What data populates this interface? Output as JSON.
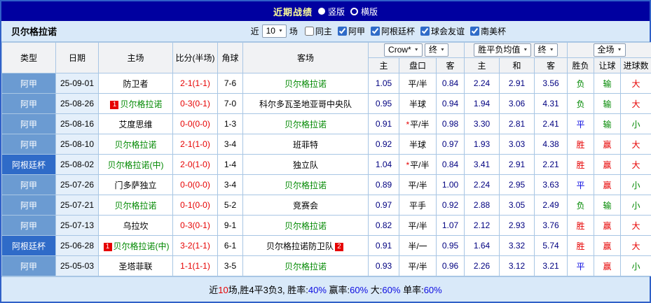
{
  "titlebar": {
    "title": "近期战绩",
    "options": [
      {
        "label": "竖版",
        "selected": true
      },
      {
        "label": "横版",
        "selected": false
      }
    ]
  },
  "filterbar": {
    "team": "贝尔格拉诺",
    "near_label": "近",
    "count": "10",
    "games_label": "场",
    "checkboxes": [
      {
        "label": "同主",
        "checked": false
      },
      {
        "label": "阿甲",
        "checked": true
      },
      {
        "label": "阿根廷杯",
        "checked": true
      },
      {
        "label": "球会友谊",
        "checked": true
      },
      {
        "label": "南美杯",
        "checked": true
      }
    ]
  },
  "colors": {
    "red": "#E60000",
    "green": "#008800",
    "blue": "#0B0BE0",
    "black": "#000000",
    "navy": "#000080",
    "league_cell": "#6B9BD2",
    "cup_cell": "#2F6BC8",
    "titlebar": "#0000A0",
    "panel_bg": "#D9E9F9"
  },
  "table": {
    "columns": {
      "type": "类型",
      "date": "日期",
      "home": "主场",
      "score": "比分(半场)",
      "corner": "角球",
      "away": "客场"
    },
    "groups": [
      {
        "selects": [
          "Crow*",
          "终"
        ],
        "sub": [
          "主",
          "盘口",
          "客"
        ]
      },
      {
        "selects": [
          "胜平负均值",
          "终"
        ],
        "sub": [
          "主",
          "和",
          "客"
        ]
      },
      {
        "selects": [
          "全场"
        ],
        "sub": [
          "胜负",
          "让球",
          "进球数"
        ]
      }
    ],
    "rows": [
      {
        "type": "阿甲",
        "cup": false,
        "date": "25-09-01",
        "home": {
          "text": "防卫者",
          "green": false
        },
        "score": "2-1(1-1)",
        "corner": "7-6",
        "away": {
          "text": "贝尔格拉诺",
          "green": true
        },
        "asian": [
          "1.05",
          "平/半",
          "0.84"
        ],
        "star": false,
        "europe": [
          "2.24",
          "2.91",
          "3.56"
        ],
        "result": {
          "text": "负",
          "color": "green"
        },
        "cover": {
          "text": "输",
          "color": "green"
        },
        "total": {
          "text": "大",
          "color": "red"
        }
      },
      {
        "type": "阿甲",
        "cup": false,
        "date": "25-08-26",
        "home": {
          "text": "贝尔格拉诺",
          "green": true,
          "badge_before": "1"
        },
        "score": "0-3(0-1)",
        "corner": "7-0",
        "away": {
          "text": "科尔多瓦圣地亚哥中央队",
          "green": false
        },
        "asian": [
          "0.95",
          "半球",
          "0.94"
        ],
        "star": false,
        "europe": [
          "1.94",
          "3.06",
          "4.31"
        ],
        "result": {
          "text": "负",
          "color": "green"
        },
        "cover": {
          "text": "输",
          "color": "green"
        },
        "total": {
          "text": "大",
          "color": "red"
        }
      },
      {
        "type": "阿甲",
        "cup": false,
        "date": "25-08-16",
        "home": {
          "text": "艾度思维",
          "green": false
        },
        "score": "0-0(0-0)",
        "corner": "1-3",
        "away": {
          "text": "贝尔格拉诺",
          "green": true
        },
        "asian": [
          "0.91",
          "平/半",
          "0.98"
        ],
        "star": true,
        "europe": [
          "3.30",
          "2.81",
          "2.41"
        ],
        "result": {
          "text": "平",
          "color": "blue"
        },
        "cover": {
          "text": "输",
          "color": "green"
        },
        "total": {
          "text": "小",
          "color": "green"
        }
      },
      {
        "type": "阿甲",
        "cup": false,
        "date": "25-08-10",
        "home": {
          "text": "贝尔格拉诺",
          "green": true
        },
        "score": "2-1(1-0)",
        "corner": "3-4",
        "away": {
          "text": "班菲特",
          "green": false
        },
        "asian": [
          "0.92",
          "半球",
          "0.97"
        ],
        "star": false,
        "europe": [
          "1.93",
          "3.03",
          "4.38"
        ],
        "result": {
          "text": "胜",
          "color": "red"
        },
        "cover": {
          "text": "赢",
          "color": "red"
        },
        "total": {
          "text": "大",
          "color": "red"
        }
      },
      {
        "type": "阿根廷杯",
        "cup": true,
        "date": "25-08-02",
        "home": {
          "text": "贝尔格拉诺(中)",
          "green": true
        },
        "score": "2-0(1-0)",
        "corner": "1-4",
        "away": {
          "text": "独立队",
          "green": false
        },
        "asian": [
          "1.04",
          "平/半",
          "0.84"
        ],
        "star": true,
        "europe": [
          "3.41",
          "2.91",
          "2.21"
        ],
        "result": {
          "text": "胜",
          "color": "red"
        },
        "cover": {
          "text": "赢",
          "color": "red"
        },
        "total": {
          "text": "大",
          "color": "red"
        }
      },
      {
        "type": "阿甲",
        "cup": false,
        "date": "25-07-26",
        "home": {
          "text": "门多萨独立",
          "green": false
        },
        "score": "0-0(0-0)",
        "corner": "3-4",
        "away": {
          "text": "贝尔格拉诺",
          "green": true
        },
        "asian": [
          "0.89",
          "平/半",
          "1.00"
        ],
        "star": false,
        "europe": [
          "2.24",
          "2.95",
          "3.63"
        ],
        "result": {
          "text": "平",
          "color": "blue"
        },
        "cover": {
          "text": "赢",
          "color": "red"
        },
        "total": {
          "text": "小",
          "color": "green"
        }
      },
      {
        "type": "阿甲",
        "cup": false,
        "date": "25-07-21",
        "home": {
          "text": "贝尔格拉诺",
          "green": true
        },
        "score": "0-1(0-0)",
        "corner": "5-2",
        "away": {
          "text": "竞赛会",
          "green": false
        },
        "asian": [
          "0.97",
          "平手",
          "0.92"
        ],
        "star": false,
        "europe": [
          "2.88",
          "3.05",
          "2.49"
        ],
        "result": {
          "text": "负",
          "color": "green"
        },
        "cover": {
          "text": "输",
          "color": "green"
        },
        "total": {
          "text": "小",
          "color": "green"
        }
      },
      {
        "type": "阿甲",
        "cup": false,
        "date": "25-07-13",
        "home": {
          "text": "乌拉坎",
          "green": false
        },
        "score": "0-3(0-1)",
        "corner": "9-1",
        "away": {
          "text": "贝尔格拉诺",
          "green": true
        },
        "asian": [
          "0.82",
          "平/半",
          "1.07"
        ],
        "star": false,
        "europe": [
          "2.12",
          "2.93",
          "3.76"
        ],
        "result": {
          "text": "胜",
          "color": "red"
        },
        "cover": {
          "text": "赢",
          "color": "red"
        },
        "total": {
          "text": "大",
          "color": "red"
        }
      },
      {
        "type": "阿根廷杯",
        "cup": true,
        "date": "25-06-28",
        "home": {
          "text": "贝尔格拉诺(中)",
          "green": true,
          "badge_before": "1"
        },
        "score": "3-2(1-1)",
        "corner": "6-1",
        "away": {
          "text": "贝尔格拉诺防卫队",
          "green": false,
          "badge_after": "2"
        },
        "asian": [
          "0.91",
          "半/一",
          "0.95"
        ],
        "star": false,
        "europe": [
          "1.64",
          "3.32",
          "5.74"
        ],
        "result": {
          "text": "胜",
          "color": "red"
        },
        "cover": {
          "text": "赢",
          "color": "red"
        },
        "total": {
          "text": "大",
          "color": "red"
        }
      },
      {
        "type": "阿甲",
        "cup": false,
        "date": "25-05-03",
        "home": {
          "text": "圣塔菲联",
          "green": false
        },
        "score": "1-1(1-1)",
        "corner": "3-5",
        "away": {
          "text": "贝尔格拉诺",
          "green": true
        },
        "asian": [
          "0.93",
          "平/半",
          "0.96"
        ],
        "star": false,
        "europe": [
          "2.26",
          "3.12",
          "3.21"
        ],
        "result": {
          "text": "平",
          "color": "blue"
        },
        "cover": {
          "text": "赢",
          "color": "red"
        },
        "total": {
          "text": "小",
          "color": "green"
        }
      }
    ]
  },
  "footer": {
    "segments": [
      {
        "text": "近",
        "color": "black"
      },
      {
        "text": "10",
        "color": "red"
      },
      {
        "text": "场,胜4平3负3, 胜率:",
        "color": "black"
      },
      {
        "text": "40%",
        "color": "blue"
      },
      {
        "text": " 赢率:",
        "color": "black"
      },
      {
        "text": "60%",
        "color": "blue"
      },
      {
        "text": " 大:",
        "color": "black"
      },
      {
        "text": "60%",
        "color": "blue"
      },
      {
        "text": " 单率:",
        "color": "black"
      },
      {
        "text": "60%",
        "color": "blue"
      }
    ]
  }
}
